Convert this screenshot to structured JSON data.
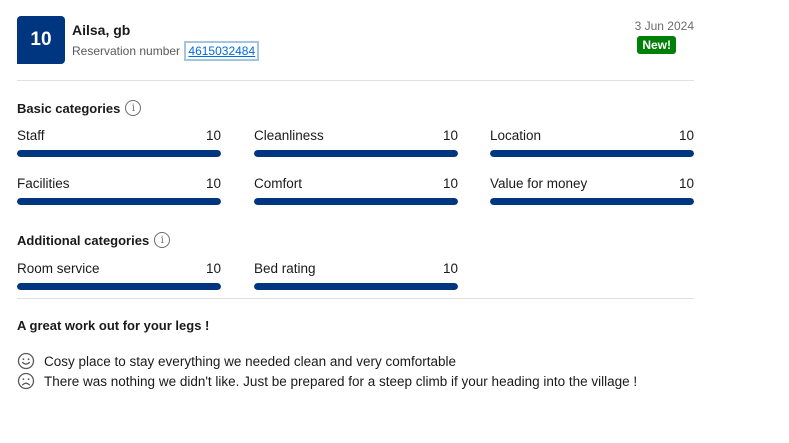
{
  "review": {
    "score": "10",
    "reviewer": "Ailsa, gb",
    "reservation_label": "Reservation number",
    "reservation_number": "4615032484",
    "date": "3 Jun 2024",
    "badge": "New!"
  },
  "basic": {
    "title": "Basic categories",
    "info_icon": "i",
    "items": [
      {
        "label": "Staff",
        "value": "10",
        "fraction": 1.0
      },
      {
        "label": "Cleanliness",
        "value": "10",
        "fraction": 1.0
      },
      {
        "label": "Location",
        "value": "10",
        "fraction": 1.0
      },
      {
        "label": "Facilities",
        "value": "10",
        "fraction": 1.0
      },
      {
        "label": "Comfort",
        "value": "10",
        "fraction": 1.0
      },
      {
        "label": "Value for money",
        "value": "10",
        "fraction": 1.0
      }
    ]
  },
  "additional": {
    "title": "Additional categories",
    "info_icon": "i",
    "items": [
      {
        "label": "Room service",
        "value": "10",
        "fraction": 1.0
      },
      {
        "label": "Bed rating",
        "value": "10",
        "fraction": 1.0
      }
    ]
  },
  "content": {
    "title": "A great work out for your legs !",
    "positive": "Cosy place to stay everything we needed clean and very comfortable",
    "negative": "There was nothing we didn't like. Just be prepared for a steep climb if your heading into the village !"
  },
  "colors": {
    "accent": "#003580",
    "new_badge": "#008009",
    "link": "#006ce4"
  },
  "icons": {
    "positive": "smiling-face-icon",
    "negative": "frowning-face-icon",
    "info": "info-icon"
  }
}
